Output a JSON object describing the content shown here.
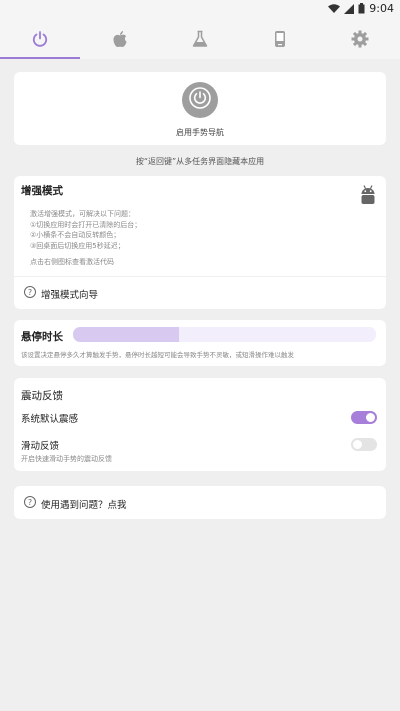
{
  "status_bar": {
    "time": "9:04",
    "icons": [
      "wifi-icon",
      "signal-icon",
      "battery-icon"
    ]
  },
  "tabs": [
    {
      "icon": "power-icon",
      "selected": true
    },
    {
      "icon": "apple-icon",
      "selected": false
    },
    {
      "icon": "flask-icon",
      "selected": false
    },
    {
      "icon": "phone-icon",
      "selected": false
    },
    {
      "icon": "gear-icon",
      "selected": false
    }
  ],
  "power_card": {
    "label": "启用手势导航"
  },
  "hint": "按“返回键”从多任务界面隐藏本应用",
  "enhanced": {
    "title": "增强模式",
    "desc_lines": [
      "激活增强模式，可解决以下问题：",
      "①切换应用时会打开已清除的后台；",
      "②小横条不会自动反转颜色；",
      "③回桌面后切换应用5秒延迟；"
    ],
    "footer": "点击右侧图标查看激活代码",
    "guide": "增强模式向导"
  },
  "hover": {
    "title": "悬停时长",
    "progress_fraction": 0.35,
    "desc": "该设置决定悬停多久才算触发手势，悬停时长越短可能会导致手势不灵敏，或短滑操作难以触发"
  },
  "vibration": {
    "title": "震动反馈",
    "system_label": "系统默认震感",
    "system_on": true,
    "slide_label": "滑动反馈",
    "slide_desc": "开启快速滑动手势的震动反馈",
    "slide_on": false
  },
  "help": {
    "text": "使用遇到问题？点我"
  },
  "colors": {
    "accent": "#a77ed9",
    "progress": "#d8c9f1",
    "background": "#efefef"
  }
}
